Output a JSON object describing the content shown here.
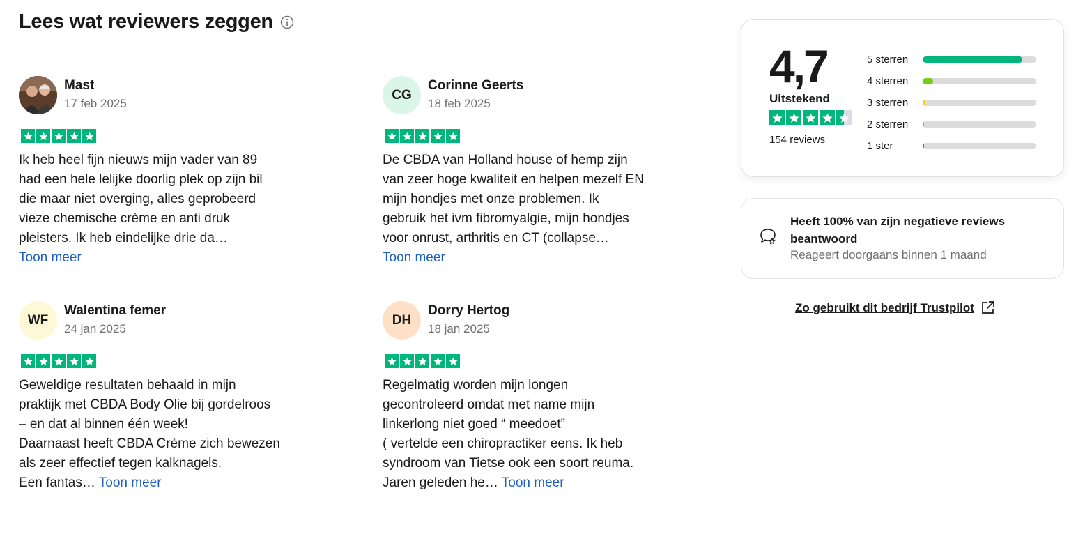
{
  "header": {
    "title": "Lees wat reviewers zeggen",
    "info_icon": "info-circle-icon"
  },
  "reviews": [
    {
      "name": "Mast",
      "avatar": "photo",
      "date": "17 feb 2025",
      "stars": 5,
      "text": [
        "Ik heb heel fijn nieuws mijn vader van 89",
        "had een hele lelijke doorlig plek op zijn bil",
        "die maar niet overging, alles geprobeerd",
        "vieze chemische crème en anti druk",
        "pleisters. Ik heb eindelijke drie da…"
      ],
      "more": "Toon meer"
    },
    {
      "name": "Corinne Geerts",
      "initials": "CG",
      "date": "18 feb 2025",
      "stars": 5,
      "text": [
        "De CBDA van Holland house of hemp zijn",
        "van zeer hoge kwaliteit en helpen mezelf EN",
        "mijn hondjes met onze problemen. Ik",
        "gebruik het ivm fibromyalgie, mijn hondjes",
        "voor onrust, arthritis en CT (collapse…"
      ],
      "more": "Toon meer"
    },
    {
      "name": "Walentina femer",
      "initials": "WF",
      "date": "24 jan 2025",
      "stars": 5,
      "text": [
        "Geweldige resultaten behaald in mijn",
        "praktijk met CBDA Body Olie bij gordelroos",
        "– en dat al binnen één week!",
        "Daarnaast heeft CBDA Crème zich bewezen",
        "als zeer effectief tegen kalknagels."
      ],
      "last_line": "Een fantas…",
      "more": "Toon meer"
    },
    {
      "name": "Dorry Hertog",
      "initials": "DH",
      "date": "18 jan 2025",
      "stars": 5,
      "text": [
        "Regelmatig worden mijn longen",
        "gecontroleerd omdat met name mijn",
        "linkerlong niet goed “ meedoet”",
        "( vertelde een chiropractiker eens. Ik heb",
        "syndroom van Tietse ook een soort reuma."
      ],
      "last_line": "Jaren geleden he…",
      "more": "Toon meer"
    }
  ],
  "summary": {
    "score": "4,7",
    "verdict": "Uitstekend",
    "stars_value": 4.5,
    "count": "154 reviews",
    "distribution": [
      {
        "label": "5 sterren",
        "fraction": 0.88,
        "color": "#00b67a"
      },
      {
        "label": "4 sterren",
        "fraction": 0.09,
        "color": "#73cf11"
      },
      {
        "label": "3 sterren",
        "fraction": 0.02,
        "color": "#ffce00"
      },
      {
        "label": "2 sterren",
        "fraction": 0.01,
        "color": "#ff8622"
      },
      {
        "label": "1 ster",
        "fraction": 0.01,
        "color": "#ff3722"
      }
    ]
  },
  "reply_stats": {
    "icon": "speech-bubble-star-icon",
    "title": "Heeft 100% van zijn negatieve reviews beantwoord",
    "subtitle": "Reageert doorgaans binnen 1 maand"
  },
  "trustpilot_link": {
    "label": "Zo gebruikt dit bedrijf Trustpilot",
    "icon": "external-link-icon"
  },
  "colors": {
    "star_green": "#00b67a",
    "link_blue": "#1f5fbf"
  }
}
